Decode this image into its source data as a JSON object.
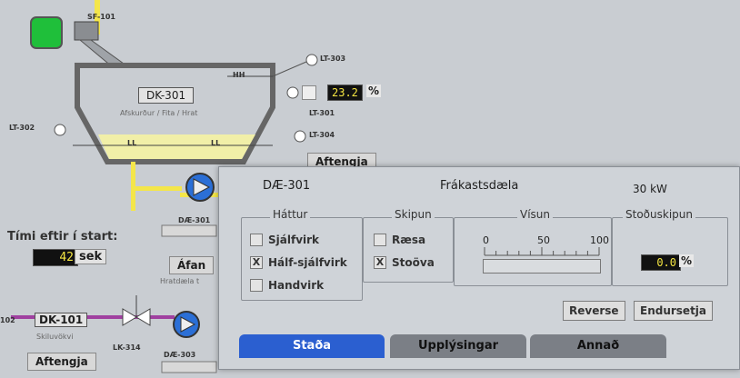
{
  "process": {
    "fan_tag": "SF-101",
    "tank": {
      "id": "DK-301",
      "subtitle": "Afskurður / Fita / Hrat",
      "hh": "HH",
      "ll_left": "LL",
      "ll_right": "LL"
    },
    "level_tags": {
      "lt303": "LT-303",
      "lt301": "LT-301",
      "lt302": "LT-302",
      "lt304": "LT-304"
    },
    "level_value": "23.2",
    "level_unit": "%",
    "aftengja_top": "Aftengja",
    "pump_de301": "DÆ-301",
    "start_label": "Tími eftir í start:",
    "start_value": "42",
    "start_unit": "sek",
    "afan_btn": "Áfan",
    "hratdaela": "Hratdæla t",
    "tank2": {
      "id": "DK-101",
      "subtitle": "Skiluvökvi",
      "left_tag": "102"
    },
    "valve_tag": "LK-314",
    "pump_de303": "DÆ-303",
    "aftengja_bottom": "Aftengja"
  },
  "popup": {
    "title_id": "DÆ-301",
    "title_name": "Frákastsdæla",
    "power": "30 kW",
    "hattur": {
      "title": "Háttur",
      "options": [
        {
          "label": "Sjálfvirk",
          "mark": ""
        },
        {
          "label": "Hálf-sjálfvirk",
          "mark": "X"
        },
        {
          "label": "Handvirk",
          "mark": ""
        }
      ]
    },
    "skipun": {
      "title": "Skipun",
      "options": [
        {
          "label": "Ræsa",
          "mark": ""
        },
        {
          "label": "Stoöva",
          "mark": "X"
        }
      ]
    },
    "visun": {
      "title": "Vísun",
      "scale": [
        "0",
        "50",
        "100"
      ],
      "value_fraction": 0
    },
    "stodu": {
      "title": "Stoðuskipun",
      "value": "0.0",
      "unit": "%"
    },
    "buttons": {
      "reverse": "Reverse",
      "reset": "Endursetja"
    },
    "tabs": [
      "Staða",
      "Upplýsingar",
      "Annað"
    ]
  },
  "colors": {
    "fan_green": "#1fbf3a",
    "pump_blue": "#2b6fd6",
    "pipe_yellow": "#f4e64a",
    "pipe_purple": "#a040a0",
    "tank_fill": "#f1efa8",
    "tab_active": "#2b5fd0",
    "tab_inactive": "#7b7f86"
  }
}
